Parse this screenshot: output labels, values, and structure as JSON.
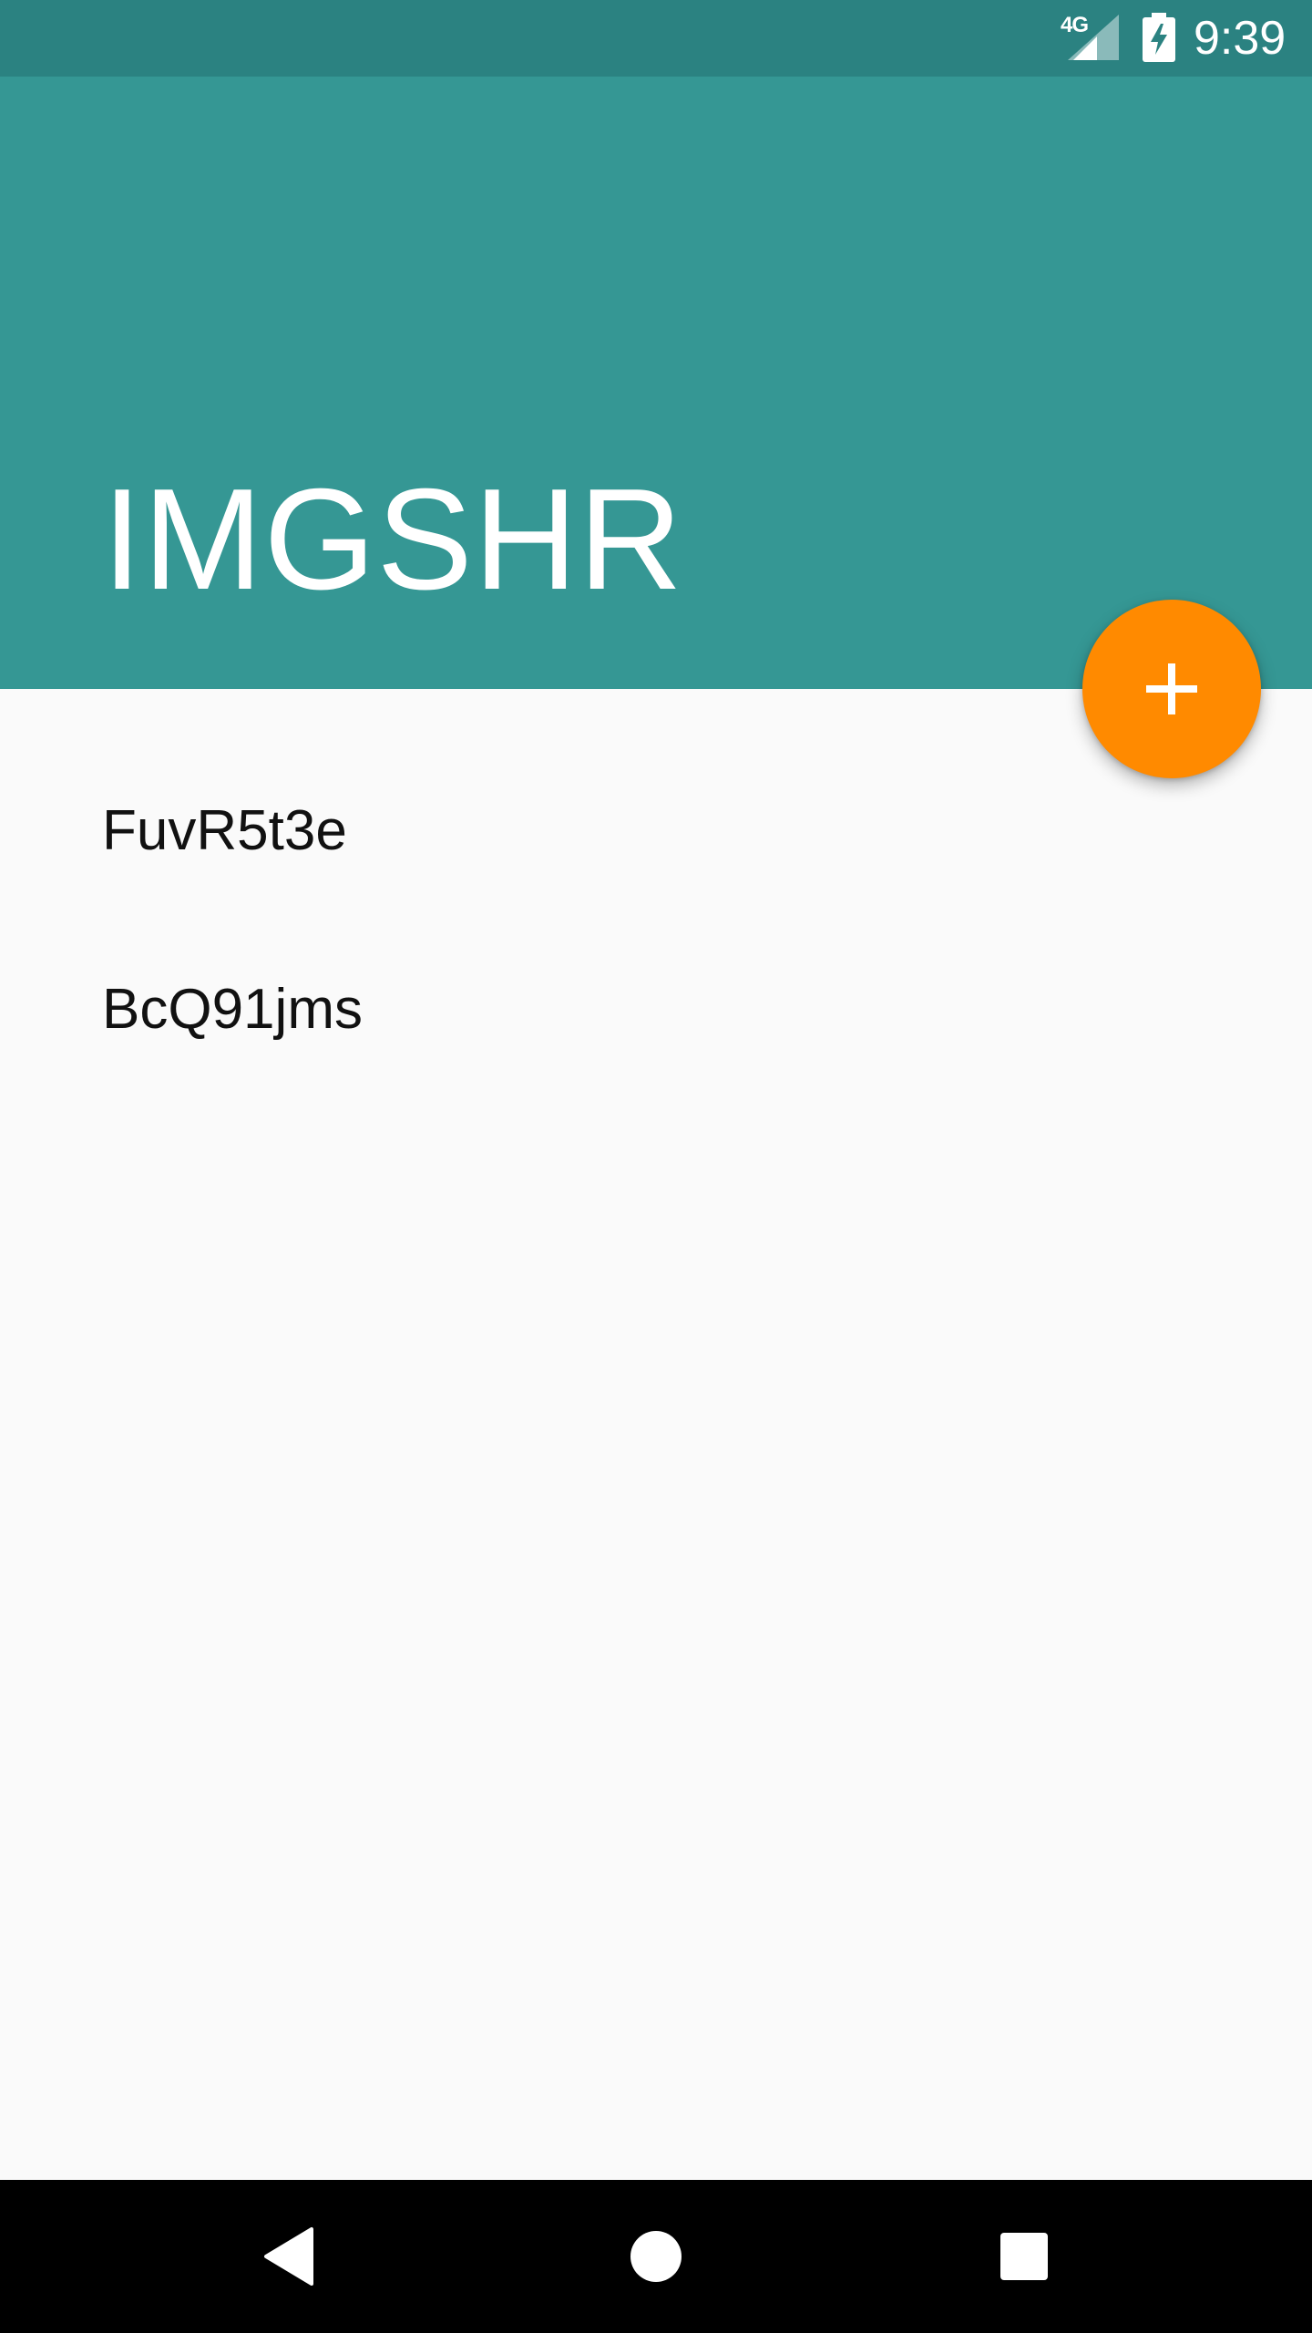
{
  "status_bar": {
    "network": "4G",
    "time": "9:39",
    "icons": [
      "cellular-signal-icon",
      "battery-charging-icon"
    ]
  },
  "header": {
    "title": "IMGSHR"
  },
  "fab": {
    "icon": "plus-icon",
    "color": "#ff8a00"
  },
  "gallery": {
    "items": [
      {
        "label": "FuvR5t3e"
      },
      {
        "label": "BcQ91jms"
      }
    ]
  },
  "nav_bar": {
    "buttons": [
      "back-icon",
      "home-icon",
      "recents-icon"
    ]
  },
  "colors": {
    "primary": "#359794",
    "primary_dark": "#2b8281",
    "accent": "#ff8a00",
    "background": "#fafafa"
  }
}
